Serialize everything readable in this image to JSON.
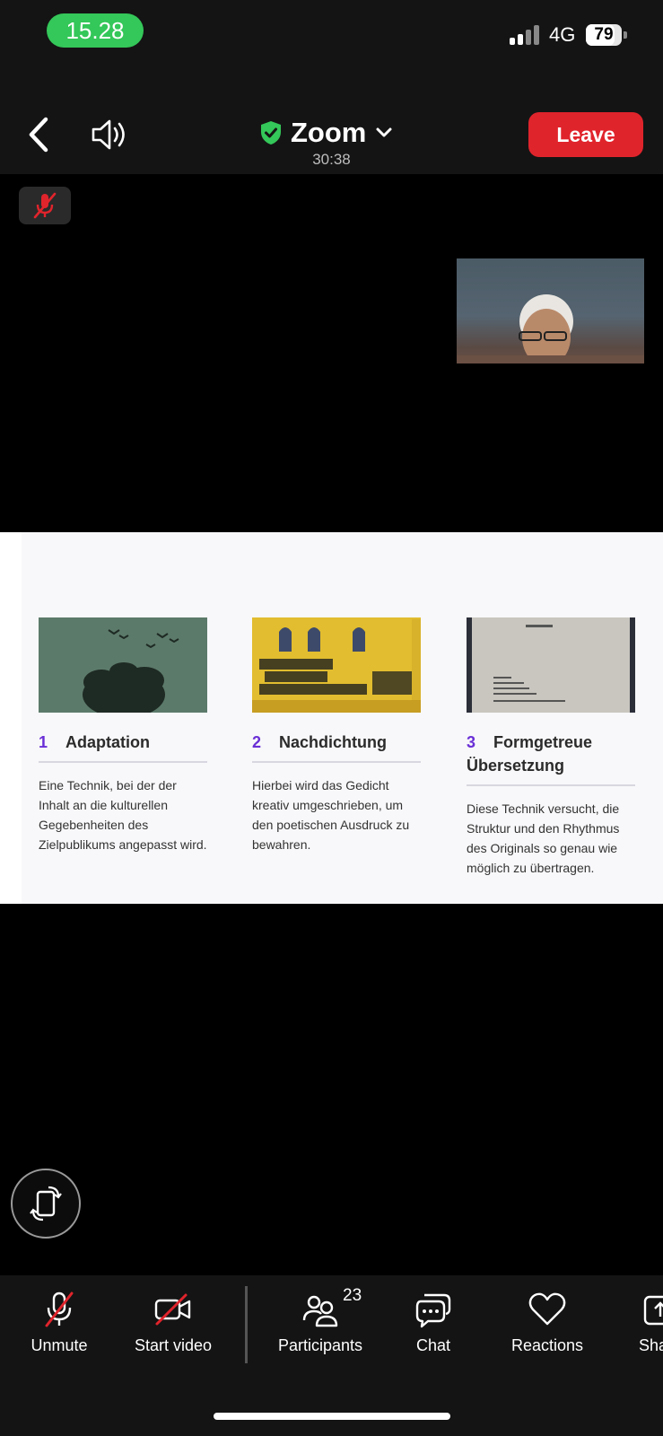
{
  "status_bar": {
    "time": "15.28",
    "network": "4G",
    "battery": "79",
    "battery_level": 0.79
  },
  "header": {
    "meeting_name": "Zoom",
    "timer": "30:38",
    "leave_label": "Leave"
  },
  "slide": {
    "columns": [
      {
        "number": "1",
        "title": "Adaptation",
        "text": "Eine Technik, bei der der Inhalt an die kulturellen Gegebenheiten des Zielpublikums angepasst wird.",
        "image": "trees-and-birds-illustration"
      },
      {
        "number": "2",
        "title": "Nachdichtung",
        "text": "Hierbei wird das Gedicht kreativ umgeschrieben, um den poetischen Ausdruck zu bewahren.",
        "image": "graffiti-wall-photo"
      },
      {
        "number": "3",
        "title": "Formgetreue Übersetzung",
        "text": "Diese Technik versucht, die Struktur und den Rhythmus des Originals so genau wie möglich zu übertragen.",
        "image": "book-page-photo"
      }
    ]
  },
  "toolbar": {
    "items": [
      {
        "label": "Unmute",
        "icon": "mic-muted-icon"
      },
      {
        "label": "Start video",
        "icon": "camera-off-icon"
      },
      {
        "label": "Participants",
        "icon": "participants-icon",
        "count": "23"
      },
      {
        "label": "Chat",
        "icon": "chat-icon"
      },
      {
        "label": "Reactions",
        "icon": "heart-icon"
      },
      {
        "label": "Share",
        "icon": "share-icon"
      }
    ]
  },
  "colors": {
    "leave": "#e0242c",
    "time_pill": "#34c759",
    "shield": "#34c759",
    "slide_accent": "#6a2fd6",
    "muted": "#e0242c"
  }
}
